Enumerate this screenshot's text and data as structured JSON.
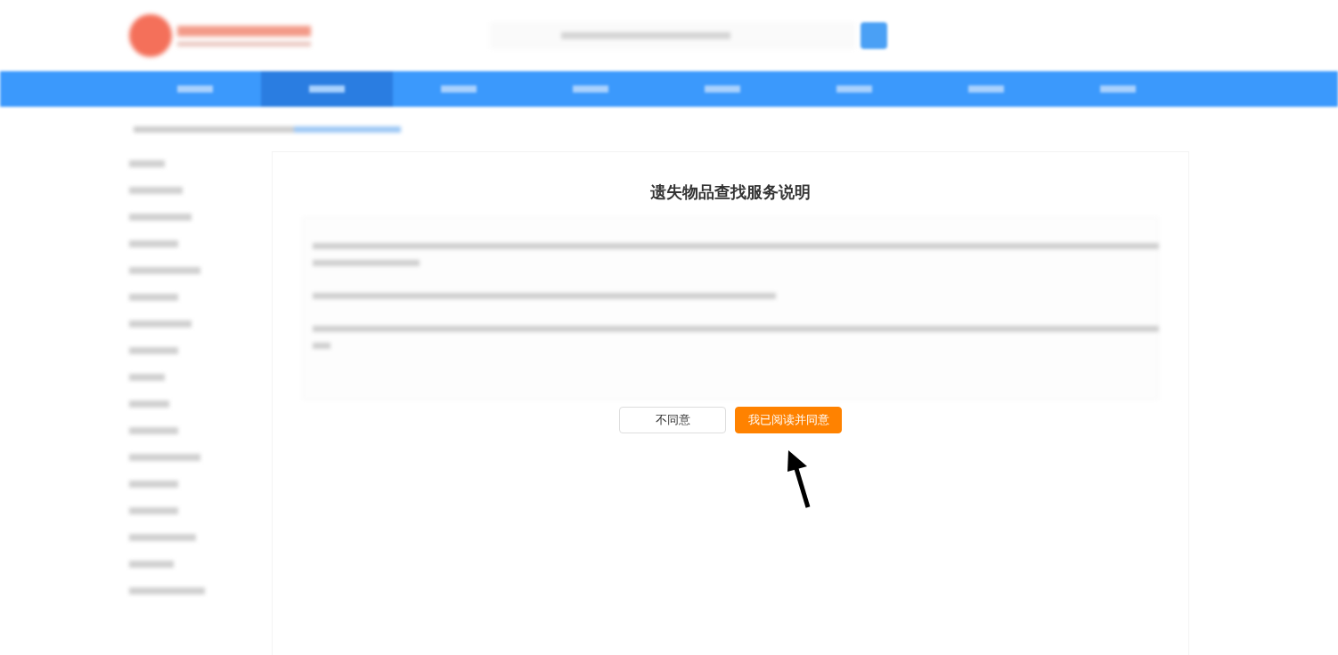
{
  "dialog": {
    "title": "遗失物品查找服务说明",
    "buttons": [
      {
        "label": "不同意",
        "kind": "secondary"
      },
      {
        "label": "我已阅读并同意",
        "kind": "primary"
      }
    ]
  }
}
